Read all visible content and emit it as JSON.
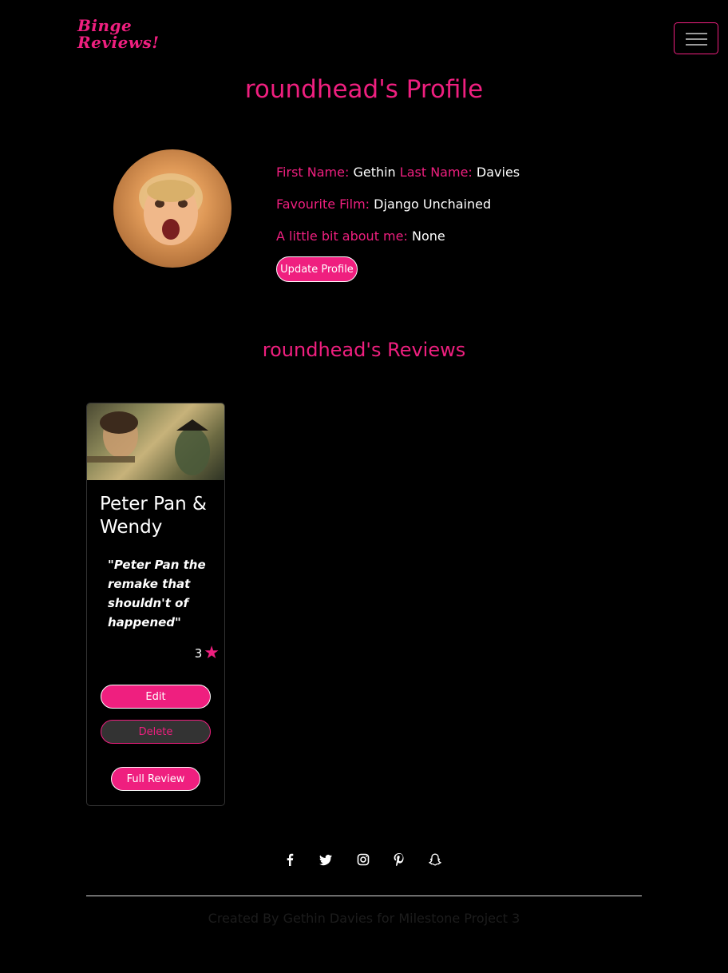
{
  "navbar": {
    "logo_line1": "Binge",
    "logo_line2": "Reviews!",
    "menu_icon": "hamburger-icon"
  },
  "profile": {
    "title": "roundhead's Profile",
    "first_name_label": "First Name:",
    "first_name": "Gethin",
    "last_name_label": "Last Name:",
    "last_name": "Davies",
    "favourite_film_label": "Favourite Film:",
    "favourite_film": "Django Unchained",
    "about_label": "A little bit about me:",
    "about": "None",
    "update_button": "Update Profile"
  },
  "reviews": {
    "title": "roundhead's Reviews",
    "cards": [
      {
        "title": "Peter Pan & Wendy",
        "quote": "\"Peter Pan the remake that shouldn't of happened\"",
        "rating": "3",
        "edit_label": "Edit",
        "delete_label": "Delete",
        "full_review_label": "Full Review"
      }
    ]
  },
  "footer": {
    "social_icons": [
      "facebook-icon",
      "twitter-icon",
      "instagram-icon",
      "pinterest-icon",
      "snapchat-icon"
    ],
    "credits": "Created By Gethin Davies for Milestone Project 3"
  },
  "colors": {
    "accent": "#ef1f7f",
    "background": "#000000",
    "delete_button_bg": "#333333"
  }
}
